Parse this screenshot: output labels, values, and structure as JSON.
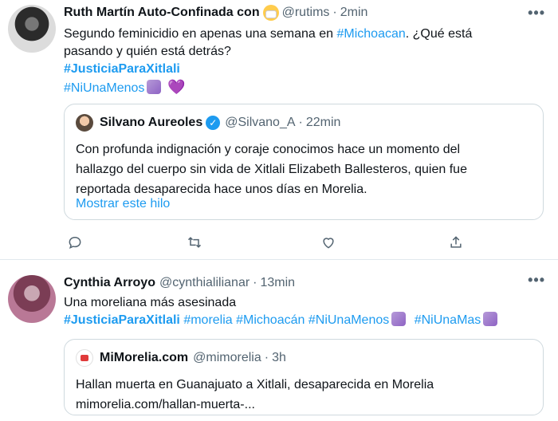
{
  "tweets": [
    {
      "author_name": "Ruth Martín Auto-Confinada con",
      "author_emoji": "mask-emoji",
      "handle": "@rutims",
      "separator": "·",
      "time": "2min",
      "more_label": "•••",
      "text_lines": [
        "Segundo feminicidio en apenas una semana en",
        "#Michoacan",
        ". ¿Qué está",
        "pasando y quién está detrás?"
      ],
      "hashtag_bold": "#JusticiaParaXitlali",
      "hashtag_extra": "#NiUnaMenos",
      "heart": "💜",
      "quote": {
        "author_name": "Silvano Aureoles",
        "verified": "✓",
        "handle": "@Silvano_A",
        "separator": "·",
        "time": "22min",
        "text_lines": [
          "Con profunda indignación y coraje conocimos hace un momento del",
          "hallazgo del cuerpo sin vida de Xitlali Elizabeth Ballesteros, quien fue",
          "reportada desaparecida hace unos días en Morelia."
        ],
        "show_thread": "Mostrar este hilo"
      }
    },
    {
      "author_name": "Cynthia Arroyo",
      "handle": "@cynthialilianar",
      "separator": "·",
      "time": "13min",
      "more_label": "•••",
      "text": "Una moreliana más asesinada",
      "hashtags": [
        "#JusticiaParaXitlali",
        "#morelia",
        "#Michoacán",
        "#NiUnaMenos",
        "#NiUnaMas"
      ],
      "quote": {
        "author_name": "MiMorelia.com",
        "handle": "@mimorelia",
        "separator": "·",
        "time": "3h",
        "text_lines": [
          "Hallan muerta en Guanajuato a Xitlali, desaparecida en Morelia",
          "mimorelia.com/hallan-muerta-..."
        ]
      }
    }
  ],
  "colors": {
    "link": "#1d9bf0",
    "muted": "#536471",
    "border": "#cfd9de",
    "heart": "#9c6ad6"
  },
  "icons": [
    "reply-icon",
    "retweet-icon",
    "like-icon",
    "share-icon",
    "more-icon",
    "verified-icon"
  ]
}
